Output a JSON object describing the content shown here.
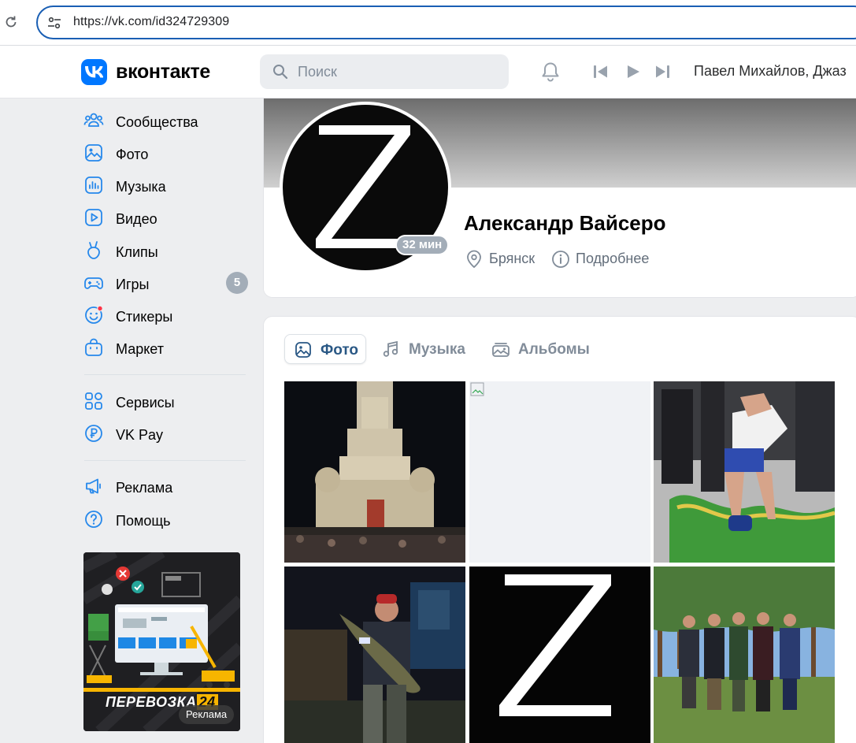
{
  "browser": {
    "url": "https://vk.com/id324729309"
  },
  "header": {
    "brand": "вконтакте",
    "search_placeholder": "Поиск",
    "now_playing": "Павел Михайлов, Джаз"
  },
  "sidebar": {
    "items": [
      {
        "label": "Сообщества",
        "icon": "communities-icon"
      },
      {
        "label": "Фото",
        "icon": "photo-icon"
      },
      {
        "label": "Музыка",
        "icon": "music-icon"
      },
      {
        "label": "Видео",
        "icon": "video-icon"
      },
      {
        "label": "Клипы",
        "icon": "clips-icon"
      },
      {
        "label": "Игры",
        "icon": "games-icon",
        "badge": "5"
      },
      {
        "label": "Стикеры",
        "icon": "stickers-icon"
      },
      {
        "label": "Маркет",
        "icon": "market-icon"
      }
    ],
    "services": [
      {
        "label": "Сервисы",
        "icon": "services-icon"
      },
      {
        "label": "VK Pay",
        "icon": "vkpay-icon"
      }
    ],
    "misc": [
      {
        "label": "Реклама",
        "icon": "megaphone-icon"
      },
      {
        "label": "Помощь",
        "icon": "help-icon"
      }
    ],
    "ad": {
      "title": "ПЕРЕВОЗКА",
      "title_num": "24",
      "label": "Реклама"
    }
  },
  "profile": {
    "name": "Александр Вайсеро",
    "online": "32 мин",
    "city": "Брянск",
    "details": "Подробнее"
  },
  "photos": {
    "tabs": [
      {
        "label": "Фото",
        "icon": "photo-icon",
        "active": true
      },
      {
        "label": "Музыка",
        "icon": "music-icon",
        "active": false
      },
      {
        "label": "Альбомы",
        "icon": "albums-icon",
        "active": false
      }
    ]
  },
  "colors": {
    "accent": "#0077ff",
    "link": "#2a5885",
    "muted": "#818c99",
    "badge": "#a3adb8"
  }
}
